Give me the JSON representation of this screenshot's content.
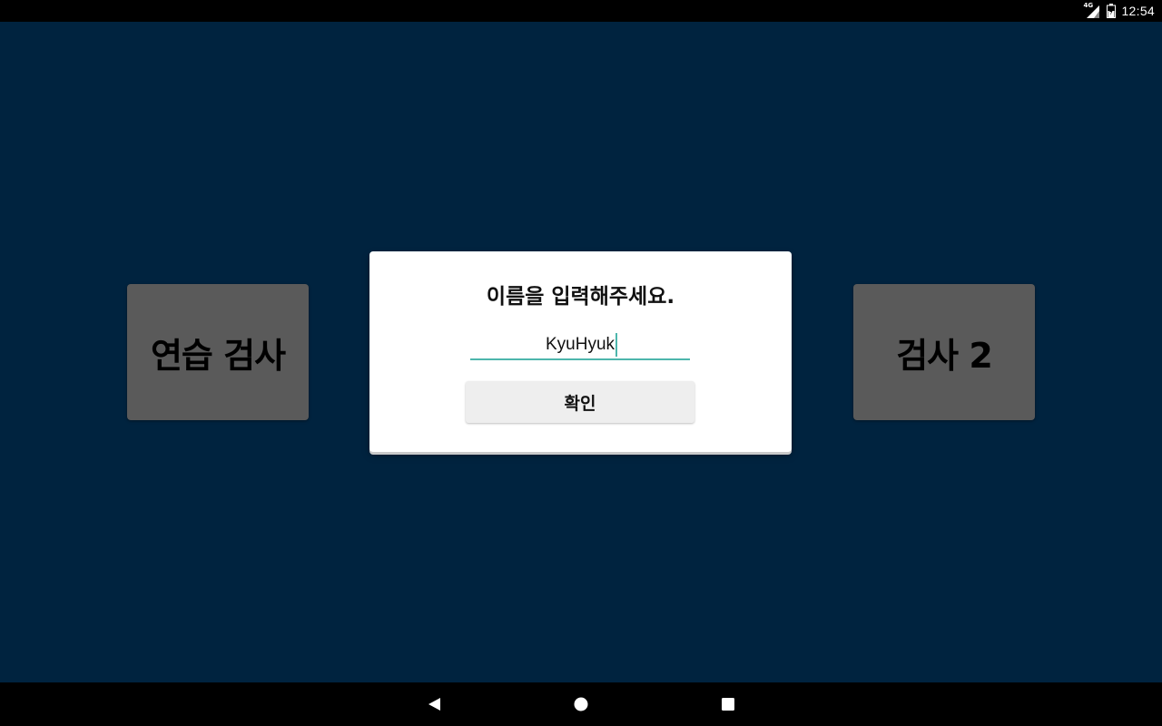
{
  "status_bar": {
    "network_type": "4G",
    "time": "12:54",
    "icons": [
      "signal-icon",
      "battery-charging-icon"
    ]
  },
  "tiles": {
    "practice_test": "연습 검사",
    "test_2": "검사 2"
  },
  "dialog": {
    "title": "이름을 입력해주세요.",
    "name_value": "KyuHyuk",
    "confirm_label": "확인"
  },
  "nav_bar": {
    "icons": [
      "back-icon",
      "home-icon",
      "recents-icon"
    ]
  },
  "colors": {
    "background": "#00233f",
    "tile": "#5a5a5a",
    "dialog": "#ffffff",
    "input_accent": "#4db6ac",
    "button": "#eeeeee",
    "system_bars": "#000000"
  }
}
